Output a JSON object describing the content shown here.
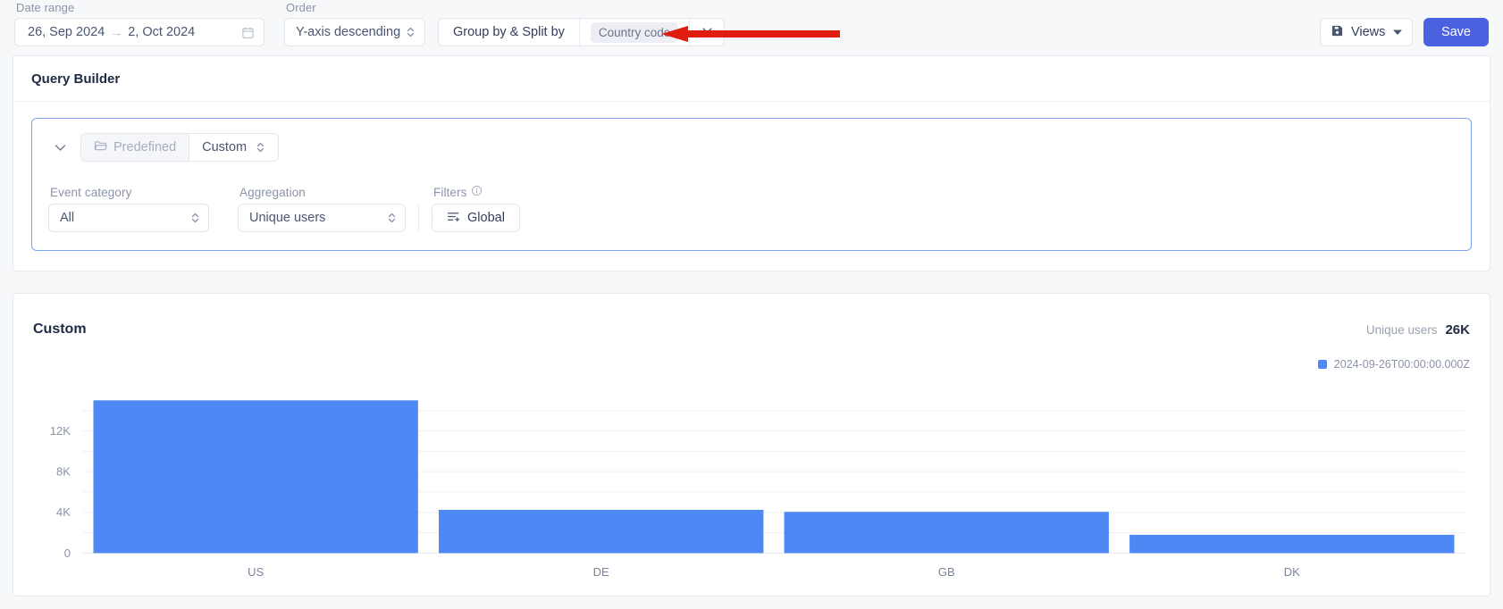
{
  "topbar": {
    "date_range": {
      "label": "Date range",
      "start": "26, Sep 2024",
      "separator": "→",
      "end": "2, Oct 2024",
      "icon": "calendar-icon"
    },
    "order": {
      "label": "Order",
      "value": "Y-axis descending"
    },
    "group_by": {
      "label": "Group by & Split by",
      "chip": "Country code",
      "clear_icon": "close-icon"
    },
    "views_button": {
      "label": "Views",
      "icon": "save-disk-icon",
      "caret": "chevron-down-icon"
    },
    "save_button": {
      "label": "Save"
    },
    "annotation": {
      "type": "arrow",
      "color": "#e11d12",
      "points_to": "group-by-clear-button"
    }
  },
  "query_builder": {
    "title": "Query Builder",
    "segmented": {
      "predefined": {
        "label": "Predefined",
        "icon": "folder-icon",
        "active": false
      },
      "custom": {
        "label": "Custom",
        "active": true
      }
    },
    "collapse_icon": "chevron-down-icon",
    "fields": {
      "event_category": {
        "label": "Event category",
        "value": "All"
      },
      "aggregation": {
        "label": "Aggregation",
        "value": "Unique users"
      },
      "filters": {
        "label": "Filters",
        "info_icon": "info-icon",
        "button": "Global",
        "button_icon": "filter-icon"
      }
    }
  },
  "chart_card": {
    "title": "Custom",
    "metric_label": "Unique users",
    "metric_value": "26K"
  },
  "chart_data": {
    "type": "bar",
    "title": "Custom",
    "categories": [
      "US",
      "DE",
      "GB",
      "DK"
    ],
    "values": [
      15000,
      4250,
      4050,
      1800
    ],
    "series": [
      {
        "name": "2024-09-26T00:00:00.000Z",
        "color": "#4e88f4",
        "values": [
          15000,
          4250,
          4050,
          1800
        ]
      }
    ],
    "legend": [
      "2024-09-26T00:00:00.000Z"
    ],
    "legend_position": "top-right",
    "xlabel": "",
    "ylabel": "",
    "ylim": [
      0,
      16000
    ],
    "yticks": [
      0,
      4000,
      8000,
      12000
    ],
    "ytick_labels": [
      "0",
      "4K",
      "8K",
      "12K"
    ],
    "minor_gridlines": [
      2000,
      6000,
      10000,
      14000
    ],
    "grid": true,
    "bar_color": "#4e88f4"
  }
}
